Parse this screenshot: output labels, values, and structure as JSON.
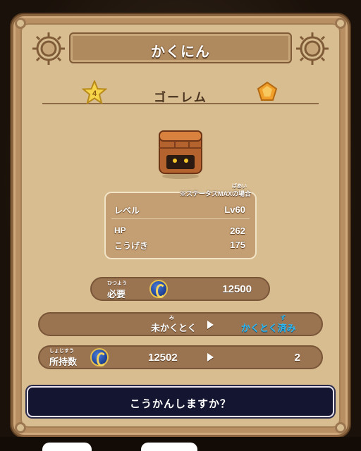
{
  "title": "かくにん",
  "monster": {
    "name": "ゴーレム",
    "rank": "4",
    "rank_icon": "star-icon",
    "element_icon": "orange-gem-icon",
    "sprite": "golem-sprite"
  },
  "stats": {
    "note": "※ステータスMAXの場合",
    "note_ruby": "ばあい",
    "rows": [
      {
        "label": "レベル",
        "value": "Lv60"
      },
      {
        "label": "HP",
        "value": "262"
      },
      {
        "label": "こうげき",
        "value": "175"
      }
    ]
  },
  "cost": {
    "label": "必要",
    "ruby": "ひつよう",
    "icon": "medal-coin-icon",
    "value": "12500"
  },
  "status_change": {
    "from": "未かくとく",
    "from_ruby": "み",
    "to": "かくとく済み",
    "to_ruby": "ず"
  },
  "owned": {
    "label": "所持数",
    "ruby": "しょじすう",
    "icon": "medal-coin-icon",
    "before": "12502",
    "after": "2"
  },
  "confirm": {
    "text": "こうかんしますか？"
  },
  "colors": {
    "panel": "#d8bd90",
    "pill": "#9a7351",
    "acquired": "#2fb7f0",
    "confirm_bg": "#141631"
  }
}
